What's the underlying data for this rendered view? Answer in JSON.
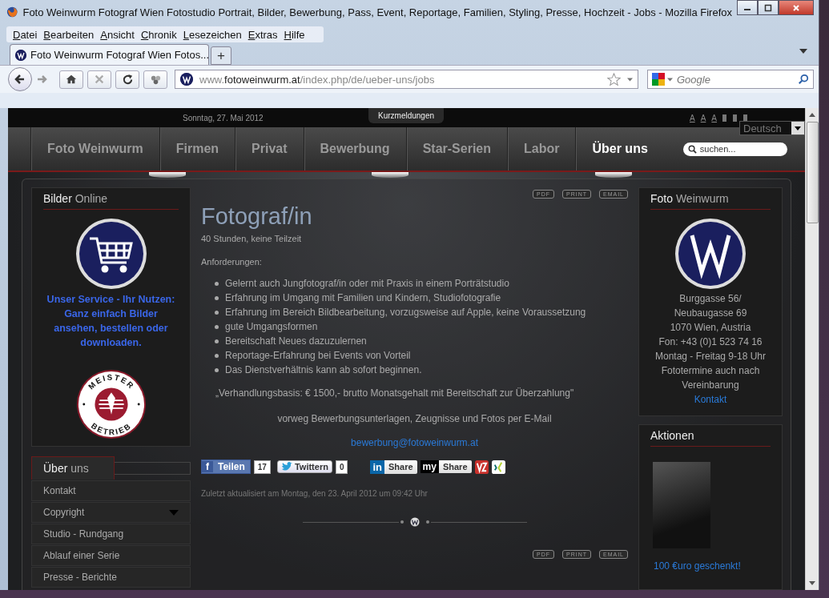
{
  "window": {
    "title": "Foto Weinwurm Fotograf Wien Fotostudio Portrait, Bilder, Bewerbung, Pass, Event, Reportage, Familien, Styling, Presse, Hochzeit - Jobs - Mozilla Firefox"
  },
  "menu": [
    "Datei",
    "Bearbeiten",
    "Ansicht",
    "Chronik",
    "Lesezeichen",
    "Extras",
    "Hilfe"
  ],
  "tabs": [
    {
      "label": "Foto Weinwurm Fotograf Wien Fotos...",
      "selected": true
    }
  ],
  "new_tab": "+",
  "address": {
    "prefix": "www.",
    "domain": "fotoweinwurm.at",
    "path": "/index.php/de/ueber-uns/jobs"
  },
  "search": {
    "placeholder": "Google"
  },
  "site": {
    "date": "Sonntag, 27. Mai 2012",
    "news_tab": "Kurzmeldungen",
    "font_sizes": [
      "A",
      "A",
      "A"
    ],
    "language": "Deutsch",
    "nav": [
      {
        "label": "Foto Weinwurm",
        "selected": false
      },
      {
        "label": "Firmen",
        "selected": false
      },
      {
        "label": "Privat",
        "selected": false
      },
      {
        "label": "Bewerbung",
        "selected": false
      },
      {
        "label": "Star-Serien",
        "selected": false
      },
      {
        "label": "Labor",
        "selected": false
      },
      {
        "label": "Über uns",
        "selected": true
      }
    ],
    "search_placeholder": "suchen..."
  },
  "left": {
    "title_first": "Bilder",
    "title_rest": "Online",
    "service": "Unser Service - Ihr Nutzen: Ganz einfach Bilder ansehen, bestellen oder downloaden.",
    "seal_top": "MEISTER",
    "seal_bottom": "BETRIEB",
    "menu_title_first": "Über",
    "menu_title_rest": "uns",
    "menu": [
      {
        "label": "Kontakt",
        "expandable": false
      },
      {
        "label": "Copyright",
        "expandable": true
      },
      {
        "label": "Studio - Rundgang",
        "expandable": false
      },
      {
        "label": "Ablauf einer Serie",
        "expandable": false
      },
      {
        "label": "Presse - Berichte",
        "expandable": false
      }
    ]
  },
  "article": {
    "tools": [
      "PDF",
      "PRINT",
      "EMAIL"
    ],
    "title": "Fotograf/in",
    "subtitle": "40 Stunden, keine Teilzeit",
    "requirements_label": "Anforderungen:",
    "requirements": [
      "Gelernt auch Jungfotograf/in oder mit Praxis in einem Porträtstudio",
      "Erfahrung im Umgang mit Familien und Kindern, Studiofotografie",
      "Erfahrung im Bereich Bildbearbeitung, vorzugsweise auf Apple, keine Voraussetzung",
      "gute Umgangsformen",
      "Bereitschaft Neues dazuzulernen",
      "Reportage-Erfahrung bei Events von Vorteil",
      "Das Dienstverhältnis kann ab sofort beginnen."
    ],
    "salary": "„Verhandlungsbasis: € 1500,- brutto Monatsgehalt mit Bereitschaft zur Überzahlung\"",
    "note": "vorweg Bewerbungsunterlagen, Zeugnisse und Fotos per E-Mail",
    "email": "bewerbung@fotoweinwurm.at",
    "share": [
      {
        "kind": "facebook",
        "logo": "f",
        "label": "Teilen",
        "count": "17"
      },
      {
        "kind": "twitter",
        "label": "Twittern",
        "count": "0"
      },
      {
        "kind": "linkedin",
        "logo": "in",
        "label": "Share"
      },
      {
        "kind": "myspace",
        "logo": "my",
        "label": "Share"
      },
      {
        "kind": "vz"
      },
      {
        "kind": "xing"
      }
    ],
    "updated": "Zuletzt aktualisiert am Montag, den 23. April 2012 um 09:42 Uhr",
    "bottom_tools": [
      "PDF",
      "PRINT",
      "EMAIL"
    ]
  },
  "right": {
    "title_first": "Foto",
    "title_rest": "Weinwurm",
    "address": [
      "Burggasse 56/",
      "Neubaugasse 69",
      "1070 Wien, Austria",
      "Fon: +43 (0)1 523 74 16",
      "Montag - Freitag 9-18 Uhr",
      "Fototermine auch nach",
      "Vereinbarung"
    ],
    "contact": "Kontakt",
    "promo_title": "Aktionen",
    "promo_link": "100 €uro geschenkt!"
  }
}
